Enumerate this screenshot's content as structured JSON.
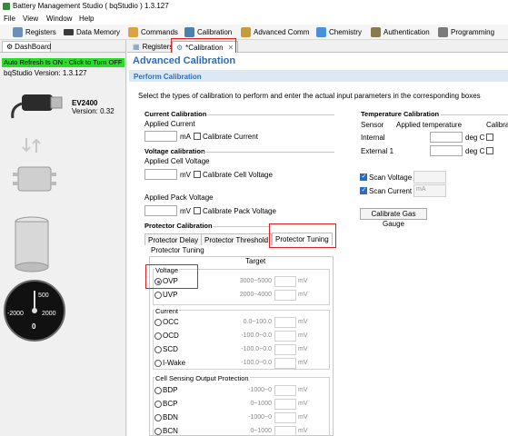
{
  "window": {
    "title": "Battery Management Studio ( bqStudio ) 1.3.127"
  },
  "menu": [
    "File",
    "View",
    "Window",
    "Help"
  ],
  "toolbar": [
    {
      "label": "Registers",
      "icon": "registers-icon"
    },
    {
      "label": "Data Memory",
      "icon": "data-memory-icon"
    },
    {
      "label": "Commands",
      "icon": "commands-icon"
    },
    {
      "label": "Calibration",
      "icon": "calibration-icon"
    },
    {
      "label": "Advanced Comm",
      "icon": "advanced-comm-icon"
    },
    {
      "label": "Chemistry",
      "icon": "chemistry-icon"
    },
    {
      "label": "Authentication",
      "icon": "authentication-icon"
    },
    {
      "label": "Programming",
      "icon": "programming-icon"
    }
  ],
  "left": {
    "tab": "DashBoard",
    "autorefresh": "Auto Refresh Is ON - Click to Turn OFF",
    "version": "bqStudio Version:  1.3.127",
    "device": "EV2400",
    "device_version": "Version: 0.32",
    "gauge": {
      "v500": "500",
      "v2000l": "-2000",
      "v2000r": "2000",
      "v0": "0"
    }
  },
  "tabs": {
    "registers": "Registers",
    "calibration": "*Calibration"
  },
  "page": {
    "title": "Advanced Calibration",
    "subtitle": "Perform Calibration",
    "instructions": "Select the types of calibration to perform and enter the actual input parameters in the corresponding boxes"
  },
  "current": {
    "title": "Current Calibration",
    "applied": "Applied Current",
    "unit": "mA",
    "check": "Calibrate Current"
  },
  "voltage": {
    "title": "Voltage calibration",
    "cell": "Applied Cell Voltage",
    "cell_unit": "mV",
    "cell_check": "Calibrate Cell Voltage",
    "pack": "Applied Pack Voltage",
    "pack_unit": "mV",
    "pack_check": "Calibrate Pack Voltage"
  },
  "temperature": {
    "title": "Temperature Calibration",
    "col_sensor": "Sensor",
    "col_applied": "Applied temperature",
    "col_cal": "Calibra",
    "rows": [
      {
        "sensor": "Internal",
        "unit": "deg C"
      },
      {
        "sensor": "External 1",
        "unit": "deg C"
      }
    ]
  },
  "scan": {
    "voltage": "Scan Voltage",
    "current": "Scan Current",
    "current_unit": "mA",
    "button": "Calibrate Gas Gauge"
  },
  "protector": {
    "title": "Protector Calibration",
    "tabs": [
      "Protector Delay",
      "Protector Threshold",
      "Protector Tuning"
    ],
    "tab_overflow": "Protector Tuning",
    "target": "Target",
    "voltage_group": "Voltage",
    "current_group": "Current",
    "cell_group": "Cell Sensing Output Protection",
    "voltage_rows": [
      {
        "name": "OVP",
        "range": "3000~5000",
        "unit": "mV",
        "selected": true
      },
      {
        "name": "UVP",
        "range": "2000~4000",
        "unit": "mV",
        "selected": false
      }
    ],
    "current_rows": [
      {
        "name": "OCC",
        "range": "0.0~100.0",
        "unit": "mV"
      },
      {
        "name": "OCD",
        "range": "-100.0~0.0",
        "unit": "mV"
      },
      {
        "name": "SCD",
        "range": "-100.0~0.0",
        "unit": "mV"
      },
      {
        "name": "I-Wake",
        "range": "-100.0~0.0",
        "unit": "mV"
      }
    ],
    "cell_rows": [
      {
        "name": "BDP",
        "range": "-1000~0",
        "unit": "mV"
      },
      {
        "name": "BCP",
        "range": "0~1000",
        "unit": "mV"
      },
      {
        "name": "BDN",
        "range": "-1000~0",
        "unit": "mV"
      },
      {
        "name": "BCN",
        "range": "0~1000",
        "unit": "mV"
      }
    ]
  }
}
